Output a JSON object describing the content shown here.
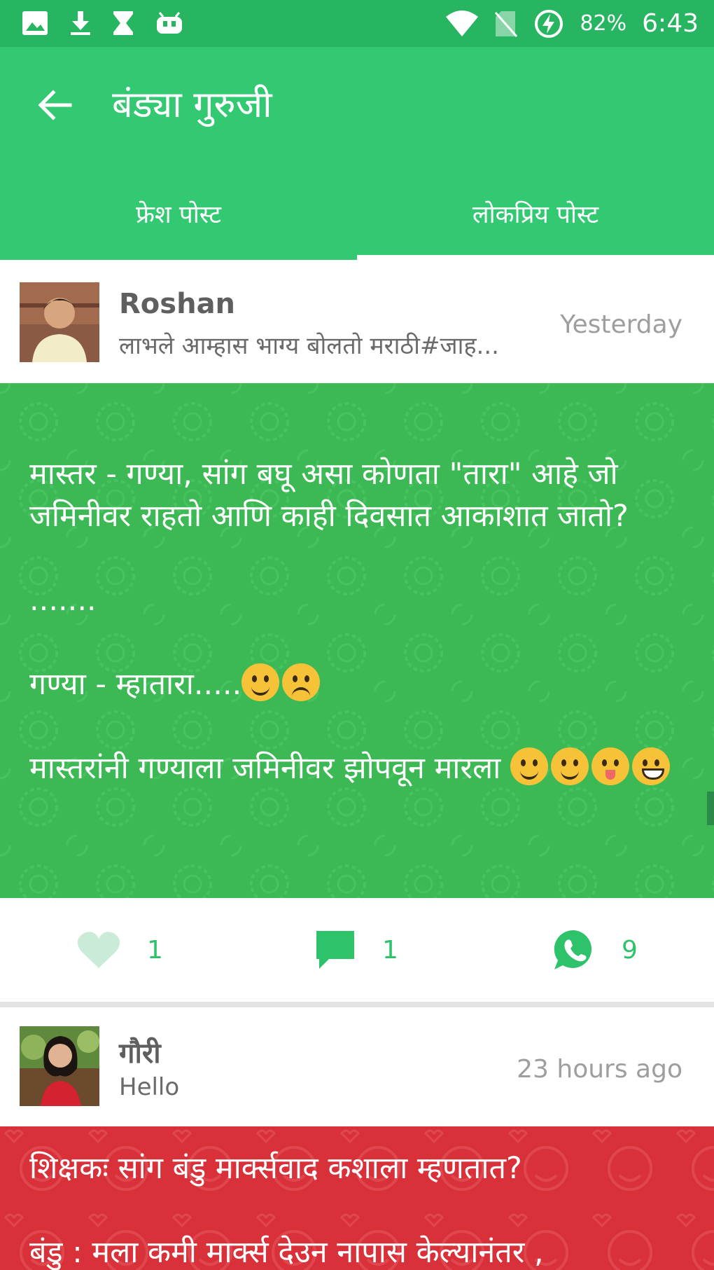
{
  "status_bar": {
    "battery_percent": "82%",
    "time": "6:43",
    "icons": [
      "image-icon",
      "download-icon",
      "hourglass-icon",
      "android-icon",
      "wifi-icon",
      "no-sim-icon",
      "battery-charging-icon"
    ]
  },
  "app_bar": {
    "title": "बंड्या गुरुजी"
  },
  "tabs": [
    {
      "label": "फ्रेश पोस्ट",
      "selected": false
    },
    {
      "label": "लोकप्रिय पोस्ट",
      "selected": true
    }
  ],
  "posts": [
    {
      "author": "Roshan",
      "excerpt": "लाभले आम्हास भाग्य बोलतो मराठी#जाह...",
      "time": "Yesterday",
      "background": "#3cb854",
      "lines": {
        "l1": "मास्तर - गण्या, सांग बघू असा     कोणता \"तारा\" आहे जो जमिनीवर राहतो आणि काही दिवसात आकाशात जातो?",
        "l2": ".......",
        "l3": "गण्या - म्हातारा.....",
        "l4": "मास्तरांनी गण्याला जमिनीवर झोपवून मारला "
      },
      "emojis": [
        "slightly-smiling-face",
        "sad-face",
        "winking-face",
        "smiling-face",
        "winking-tongue-face",
        "grinning-face"
      ],
      "likes": "1",
      "comments": "1",
      "shares": "9"
    },
    {
      "author": "गौरी",
      "excerpt": "Hello",
      "time": "23 hours ago",
      "background": "#d9313a",
      "lines": {
        "l1": "शिक्षकः सांग बंडु मार्क्सवाद कशाला म्हणतात?",
        "l2": "बंडु : मला कमी मार्क्स देउन नापास केल्यानंतर ,"
      }
    }
  ],
  "colors": {
    "status_bar": "#27b561",
    "app_bar": "#33c872",
    "accent": "#2ec26a",
    "green_post": "#3cb854",
    "red_post": "#d9313a"
  }
}
